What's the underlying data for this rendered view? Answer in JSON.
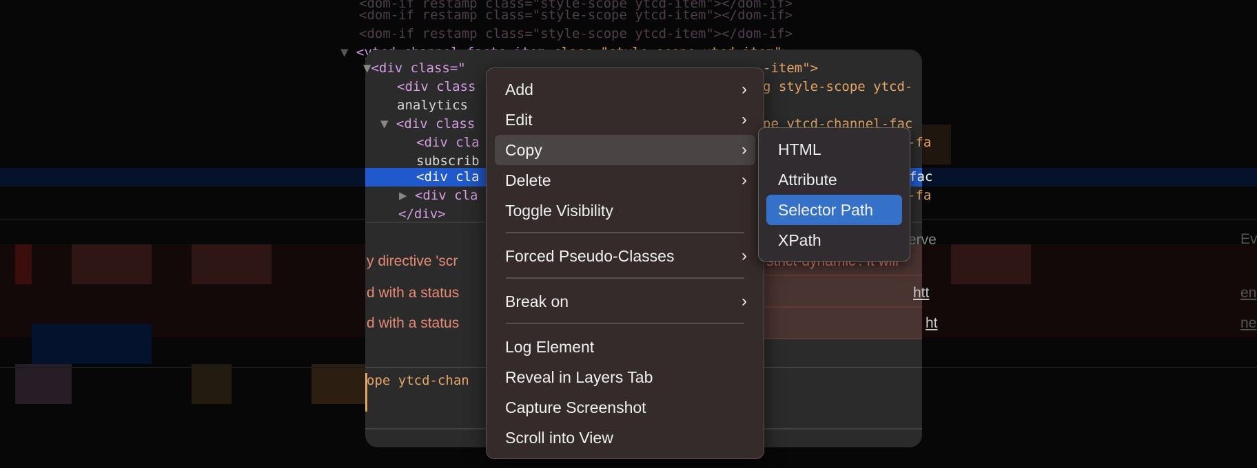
{
  "elements_panel": {
    "lines": [
      {
        "left": "<dom-if restamp class=\"style-scope ytcd-item\"></dom-if>"
      },
      {
        "left": "<dom-if restamp class=\"style-scope ytcd-item\"></dom-if>"
      },
      {
        "left": "<dom-if restamp class=\"style-scope ytcd-item\"></dom-if>"
      },
      {
        "tag": "<ytcd-channel-facts-item",
        "attr": " class=\"style-scope ytcd-item\"",
        "close": ">"
      },
      {
        "left": "<div class=\"",
        "right": "-item\">"
      },
      {
        "left": "<div class",
        "right": "g style-scope ytcd-"
      },
      {
        "left": "analytics"
      },
      {
        "left": "<div class",
        "right": "pe ytcd-channel-fac"
      },
      {
        "left": "<div cla",
        "right": "-fa"
      },
      {
        "left": "subscrib"
      },
      {
        "left": "<div cla",
        "right": "fac"
      },
      {
        "left": "<div cla",
        "right": "-fa"
      },
      {
        "left": "</div>"
      }
    ]
  },
  "console": {
    "rows": [
      {
        "left": "y directive 'scr",
        "right": "strict-dynamic'. It will"
      },
      {
        "left": "d with a status",
        "right": "htt"
      },
      {
        "left": "d with a status",
        "right": "ht"
      }
    ],
    "input_fragment": "ope ytcd-chan",
    "header_fragment": "erve",
    "right_fragments": [
      "Ev",
      "en",
      "ne"
    ]
  },
  "context_menu": {
    "items": [
      {
        "label": "Add",
        "submenu": true
      },
      {
        "label": "Edit",
        "submenu": true
      },
      {
        "label": "Copy",
        "submenu": true,
        "highlighted": true
      },
      {
        "label": "Delete",
        "submenu": true
      },
      {
        "label": "Toggle Visibility"
      },
      {
        "label": "Forced Pseudo-Classes",
        "submenu": true
      },
      {
        "label": "Break on",
        "submenu": true
      },
      {
        "label": "Log Element"
      },
      {
        "label": "Reveal in Layers Tab"
      },
      {
        "label": "Capture Screenshot"
      },
      {
        "label": "Scroll into View"
      }
    ],
    "chevron": "›"
  },
  "copy_submenu": {
    "items": [
      {
        "label": "HTML"
      },
      {
        "label": "Attribute"
      },
      {
        "label": "Selector Path",
        "selected": true
      },
      {
        "label": "XPath"
      }
    ]
  },
  "colors": {
    "selection": "#2059cc",
    "menu_selected": "#3571c8",
    "error_text": "#e88b75"
  }
}
